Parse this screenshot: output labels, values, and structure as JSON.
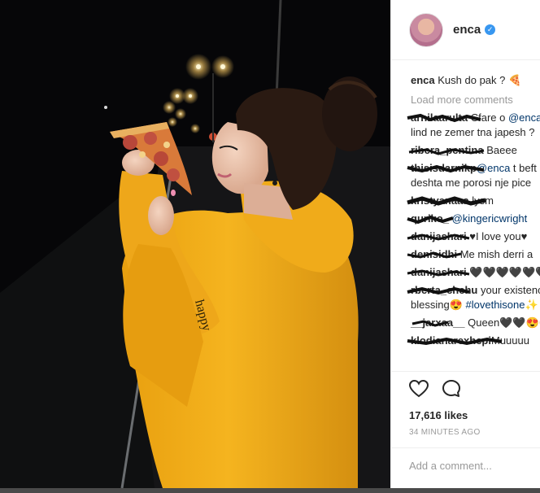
{
  "post": {
    "username": "enca",
    "caption_text": "Kush do pak ? 🍕",
    "load_more_label": "Load more comments",
    "comments": [
      {
        "user": "arnilaarulta",
        "text": "Cfare o ",
        "mention": "@enca",
        "text2": "lind ne zemer tna japesh ?"
      },
      {
        "user": "ribera_pentina",
        "text": "Baeee"
      },
      {
        "user": "thisisdarnikp",
        "mention": "@enca",
        "text": " t beft n",
        "text2": "deshta me porosi nje pice"
      },
      {
        "user": "kristyanaaa",
        "text": "lysm"
      },
      {
        "user": "quriko_",
        "mention": "@kingericwright"
      },
      {
        "user": "danijashari",
        "text": "♥I love you♥"
      },
      {
        "user": "denisidhi",
        "text": "Me mish derri a"
      },
      {
        "user": "danijashari",
        "text": "🖤🖤🖤🖤🖤🖤"
      },
      {
        "user": "rberta_chehu",
        "text": "your existence",
        "text2": "blessing😍 ",
        "tag": "#lovethisone✨"
      },
      {
        "user": "__jarxaa__",
        "text": "Queen🖤🖤😍😍"
      },
      {
        "user": "klodianarexhepi",
        "text": "Muuuuu"
      }
    ],
    "likes": "17,616 likes",
    "time_ago": "34 MINUTES AGO",
    "add_comment_placeholder": "Add a comment..."
  },
  "icons": {
    "like": "heart-icon",
    "comment": "speech-bubble-icon",
    "verified": "verified-badge-icon"
  },
  "colors": {
    "link": "#003569",
    "verified_blue": "#3897f0",
    "muted": "#999999",
    "hoodie": "#f2b01e"
  }
}
